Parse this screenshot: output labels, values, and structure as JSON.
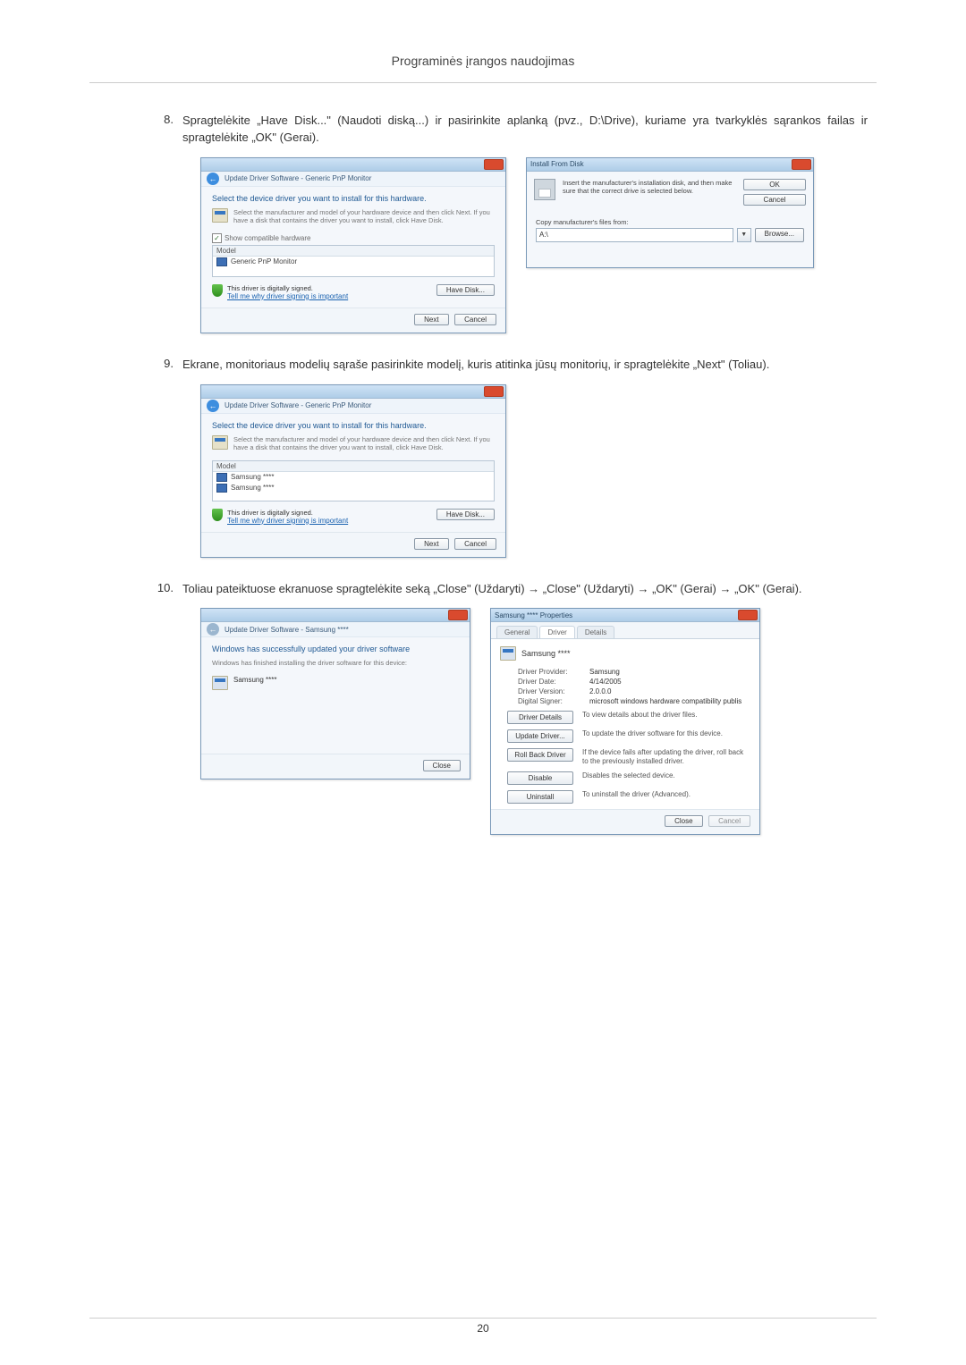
{
  "section_title": "Programinės įrangos naudojimas",
  "page_number": "20",
  "steps": {
    "s8": {
      "num": "8.",
      "text": "Spragtelėkite „Have Disk...\" (Naudoti diską...) ir pasirinkite aplanką (pvz., D:\\Drive), kuriame yra tvarkyklės sąrankos failas ir spragtelėkite „OK\" (Gerai)."
    },
    "s9": {
      "num": "9.",
      "text": "Ekrane, monitoriaus modelių sąraše pasirinkite modelį, kuris atitinka jūsų monitorių, ir spragtelėkite „Next\" (Toliau)."
    },
    "s10": {
      "num": "10.",
      "text": "Toliau pateiktuose ekranuose spragtelėkite seką „Close\" (Uždaryti) → „Close\" (Uždaryti) → „OK\" (Gerai) → „OK\" (Gerai)."
    }
  },
  "win_update1": {
    "breadcrumb": "Update Driver Software - Generic PnP Monitor",
    "heading": "Select the device driver you want to install for this hardware.",
    "subtext": "Select the manufacturer and model of your hardware device and then click Next. If you have a disk that contains the driver you want to install, click Have Disk.",
    "show_compat": "Show compatible hardware",
    "list_header": "Model",
    "list_item": "Generic PnP Monitor",
    "signed": "This driver is digitally signed.",
    "tell_me": "Tell me why driver signing is important",
    "have_disk": "Have Disk...",
    "next": "Next",
    "cancel": "Cancel"
  },
  "win_install_disk": {
    "title": "Install From Disk",
    "msg": "Insert the manufacturer's installation disk, and then make sure that the correct drive is selected below.",
    "ok": "OK",
    "cancel": "Cancel",
    "copy_label": "Copy manufacturer's files from:",
    "path": "A:\\",
    "browse": "Browse..."
  },
  "win_update2": {
    "breadcrumb": "Update Driver Software - Generic PnP Monitor",
    "heading": "Select the device driver you want to install for this hardware.",
    "subtext": "Select the manufacturer and model of your hardware device and then click Next. If you have a disk that contains the driver you want to install, click Have Disk.",
    "list_header": "Model",
    "item1": "Samsung ****",
    "item2": "Samsung ****",
    "signed": "This driver is digitally signed.",
    "tell_me": "Tell me why driver signing is important",
    "have_disk": "Have Disk...",
    "next": "Next",
    "cancel": "Cancel"
  },
  "win_success": {
    "breadcrumb": "Update Driver Software - Samsung ****",
    "heading": "Windows has successfully updated your driver software",
    "subtext": "Windows has finished installing the driver software for this device:",
    "device": "Samsung ****",
    "close": "Close"
  },
  "win_props": {
    "title": "Samsung **** Properties",
    "tabs": {
      "general": "General",
      "driver": "Driver",
      "details": "Details"
    },
    "device": "Samsung ****",
    "provider_k": "Driver Provider:",
    "provider_v": "Samsung",
    "date_k": "Driver Date:",
    "date_v": "4/14/2005",
    "version_k": "Driver Version:",
    "version_v": "2.0.0.0",
    "signer_k": "Digital Signer:",
    "signer_v": "microsoft windows hardware compatibility publis",
    "btn_details": "Driver Details",
    "desc_details": "To view details about the driver files.",
    "btn_update": "Update Driver...",
    "desc_update": "To update the driver software for this device.",
    "btn_rollback": "Roll Back Driver",
    "desc_rollback": "If the device fails after updating the driver, roll back to the previously installed driver.",
    "btn_disable": "Disable",
    "desc_disable": "Disables the selected device.",
    "btn_uninstall": "Uninstall",
    "desc_uninstall": "To uninstall the driver (Advanced).",
    "close": "Close",
    "cancel": "Cancel"
  }
}
